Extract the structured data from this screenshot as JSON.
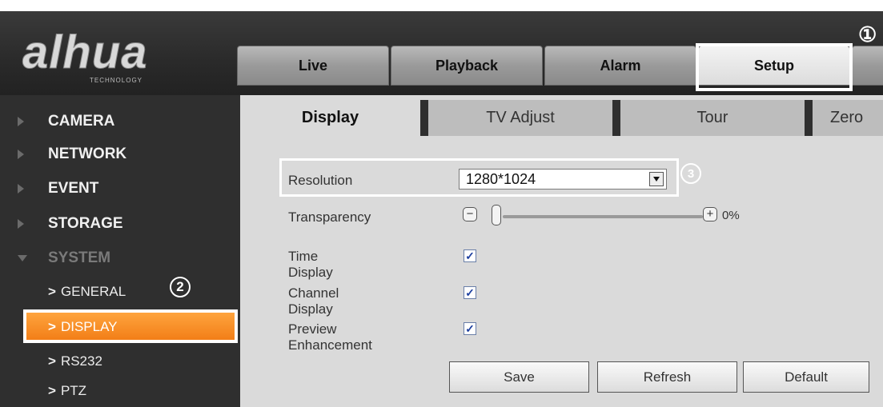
{
  "header": {
    "logo_text": "alhua",
    "logo_sub": "TECHNOLOGY",
    "tabs": [
      "Live",
      "Playback",
      "Alarm",
      "Setup"
    ],
    "active_tab": "Setup",
    "callout_1": "①"
  },
  "sidebar": {
    "sections": [
      {
        "label": "CAMERA",
        "state": "collapsed"
      },
      {
        "label": "NETWORK",
        "state": "collapsed"
      },
      {
        "label": "EVENT",
        "state": "collapsed"
      },
      {
        "label": "STORAGE",
        "state": "collapsed"
      },
      {
        "label": "SYSTEM",
        "state": "expanded"
      }
    ],
    "sub_items": [
      {
        "chevron": ">",
        "label": "GENERAL"
      },
      {
        "chevron": ">",
        "label": "DISPLAY"
      },
      {
        "chevron": ">",
        "label": "RS232"
      },
      {
        "chevron": ">",
        "label": "PTZ"
      }
    ],
    "active_sub_item": "DISPLAY",
    "callout_2": "2"
  },
  "main": {
    "subtabs": [
      "Display",
      "TV Adjust",
      "Tour",
      "Zero"
    ],
    "active_subtab": "Display",
    "resolution": {
      "label": "Resolution",
      "value": "1280*1024"
    },
    "transparency": {
      "label": "Transparency",
      "minus": "−",
      "plus": "+",
      "value_text": "0%",
      "value": 0
    },
    "time_display": {
      "label": "Time Display",
      "checked": true
    },
    "channel_display": {
      "label": "Channel Display",
      "checked": true
    },
    "preview_enhancement": {
      "label": "Preview Enhancement",
      "checked": true
    },
    "check_mark": "✓",
    "callout_3": "3",
    "buttons": {
      "save": "Save",
      "refresh": "Refresh",
      "default": "Default"
    }
  },
  "colors": {
    "header_bg": "#2a2a2a",
    "sidebar_bg": "#2f2f2f",
    "accent_orange": "#f17a13",
    "content_bg": "#dadada"
  }
}
